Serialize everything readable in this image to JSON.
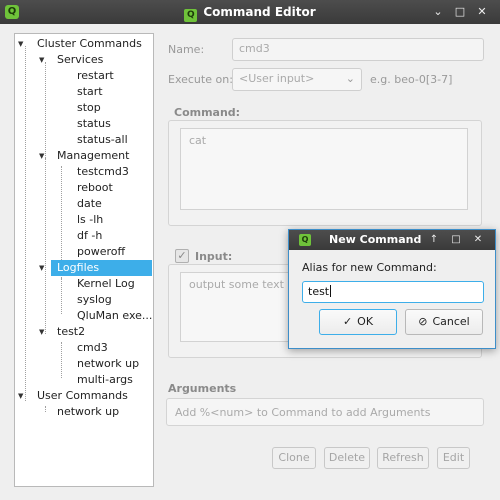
{
  "window": {
    "title": "Command Editor",
    "app_icon_letter": "Q"
  },
  "tree": {
    "root_cluster": "Cluster Commands",
    "services": {
      "label": "Services",
      "items": [
        "restart",
        "start",
        "stop",
        "status",
        "status-all"
      ]
    },
    "management": {
      "label": "Management",
      "items": [
        "testcmd3",
        "reboot",
        "date",
        "ls -lh",
        "df -h",
        "poweroff"
      ]
    },
    "logfiles": {
      "label": "Logfiles",
      "items": [
        "Kernel Log",
        "syslog",
        "QluMan exe..."
      ]
    },
    "test2": {
      "label": "test2",
      "items": [
        "cmd3",
        "network up",
        "multi-args"
      ]
    },
    "root_user": "User Commands",
    "user_items": [
      "network up"
    ]
  },
  "form": {
    "name_label": "Name:",
    "name_value": "cmd3",
    "execute_label": "Execute on:",
    "execute_value": "<User input>",
    "execute_hint": "e.g. beo-0[3-7]",
    "command_label": "Command:",
    "command_value": "cat",
    "input_label": "Input:",
    "input_value": "output some text",
    "arguments_label": "Arguments",
    "arguments_placeholder": "Add %<num> to Command to add Arguments"
  },
  "buttons": {
    "clone": "Clone",
    "delete": "Delete",
    "refresh": "Refresh",
    "edit": "Edit"
  },
  "dialog": {
    "title": "New Command",
    "icon_letter": "Q",
    "prompt": "Alias for new Command:",
    "input_value": "test",
    "ok_label": "OK",
    "cancel_label": "Cancel"
  },
  "colors": {
    "selection": "#3daee9",
    "titlebar": "#3f3f3f",
    "app_icon": "#6fc33a"
  }
}
